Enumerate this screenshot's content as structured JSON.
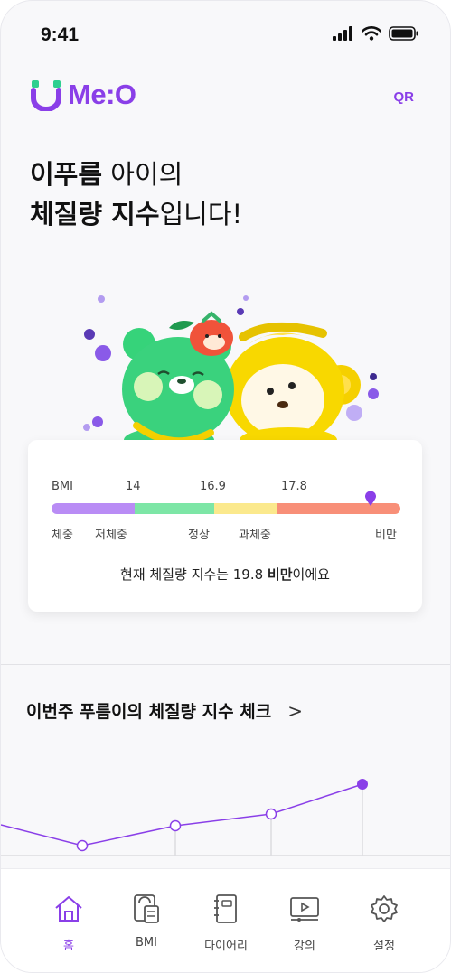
{
  "status_bar": {
    "time": "9:41"
  },
  "header": {
    "brand": "Me:O",
    "qr_label": "QR"
  },
  "headline": {
    "line1_bold": "이푸름",
    "line1_rest": " 아이의",
    "line2_bold": "체질량 지수",
    "line2_rest": "입니다!"
  },
  "bmi_card": {
    "tick_labels": [
      "BMI",
      "14",
      "16.9",
      "17.8"
    ],
    "categories": [
      "체중",
      "저체중",
      "정상",
      "과체중",
      "비만"
    ],
    "segment_colors": [
      "#b98cf5",
      "#7de6a6",
      "#fbe98d",
      "#f88f78"
    ],
    "marker_color": "#8a3fe8",
    "summary_prefix": "현재 체질량 지수는 19.8 ",
    "summary_bold": "비만",
    "summary_suffix": "이에요"
  },
  "weekly": {
    "title": "이번주 푸름이의 체질량 지수 체크",
    "chevron": ">"
  },
  "trend": {
    "line_color": "#8a3fe8"
  },
  "nav": {
    "items": [
      {
        "label": "홈",
        "icon": "home-icon",
        "active": true
      },
      {
        "label": "BMI",
        "icon": "scale-icon",
        "active": false
      },
      {
        "label": "다이어리",
        "icon": "diary-icon",
        "active": false
      },
      {
        "label": "강의",
        "icon": "lecture-icon",
        "active": false
      },
      {
        "label": "설정",
        "icon": "gear-icon",
        "active": false
      }
    ]
  }
}
